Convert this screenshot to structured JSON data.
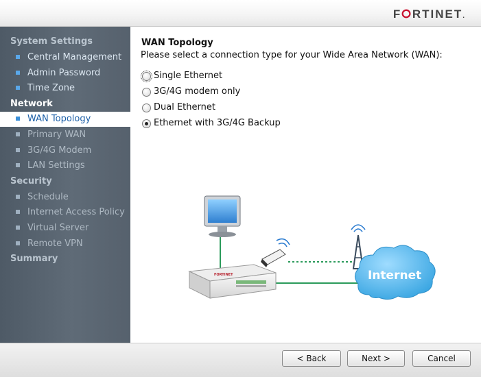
{
  "header": {
    "logo_text": "FORTINET"
  },
  "sidebar": {
    "sections": [
      {
        "label": "System Settings",
        "items": [
          "Central Management",
          "Admin Password",
          "Time Zone"
        ]
      },
      {
        "label": "Network",
        "items": [
          "WAN Topology",
          "Primary WAN",
          "3G/4G Modem",
          "LAN Settings"
        ]
      },
      {
        "label": "Security",
        "items": [
          "Schedule",
          "Internet Access Policy",
          "Virtual Server",
          "Remote VPN"
        ]
      },
      {
        "label": "Summary",
        "items": []
      }
    ],
    "selected_item": "WAN Topology"
  },
  "content": {
    "title": "WAN Topology",
    "description": "Please select a connection type for your Wide Area Network (WAN):",
    "options": [
      "Single Ethernet",
      "3G/4G modem only",
      "Dual Ethernet",
      "Ethernet with 3G/4G Backup"
    ],
    "selected_option": "Ethernet with 3G/4G Backup",
    "diagram": {
      "cloud_label": "Internet",
      "device_brand": "FORTINET"
    }
  },
  "footer": {
    "back_label": "< Back",
    "next_label": "Next >",
    "cancel_label": "Cancel"
  },
  "colors": {
    "sidebar_bg": "#56616d",
    "selected_text": "#1b5fa8",
    "cloud": "#4fb6ea",
    "link_line": "#2a9a5a"
  }
}
